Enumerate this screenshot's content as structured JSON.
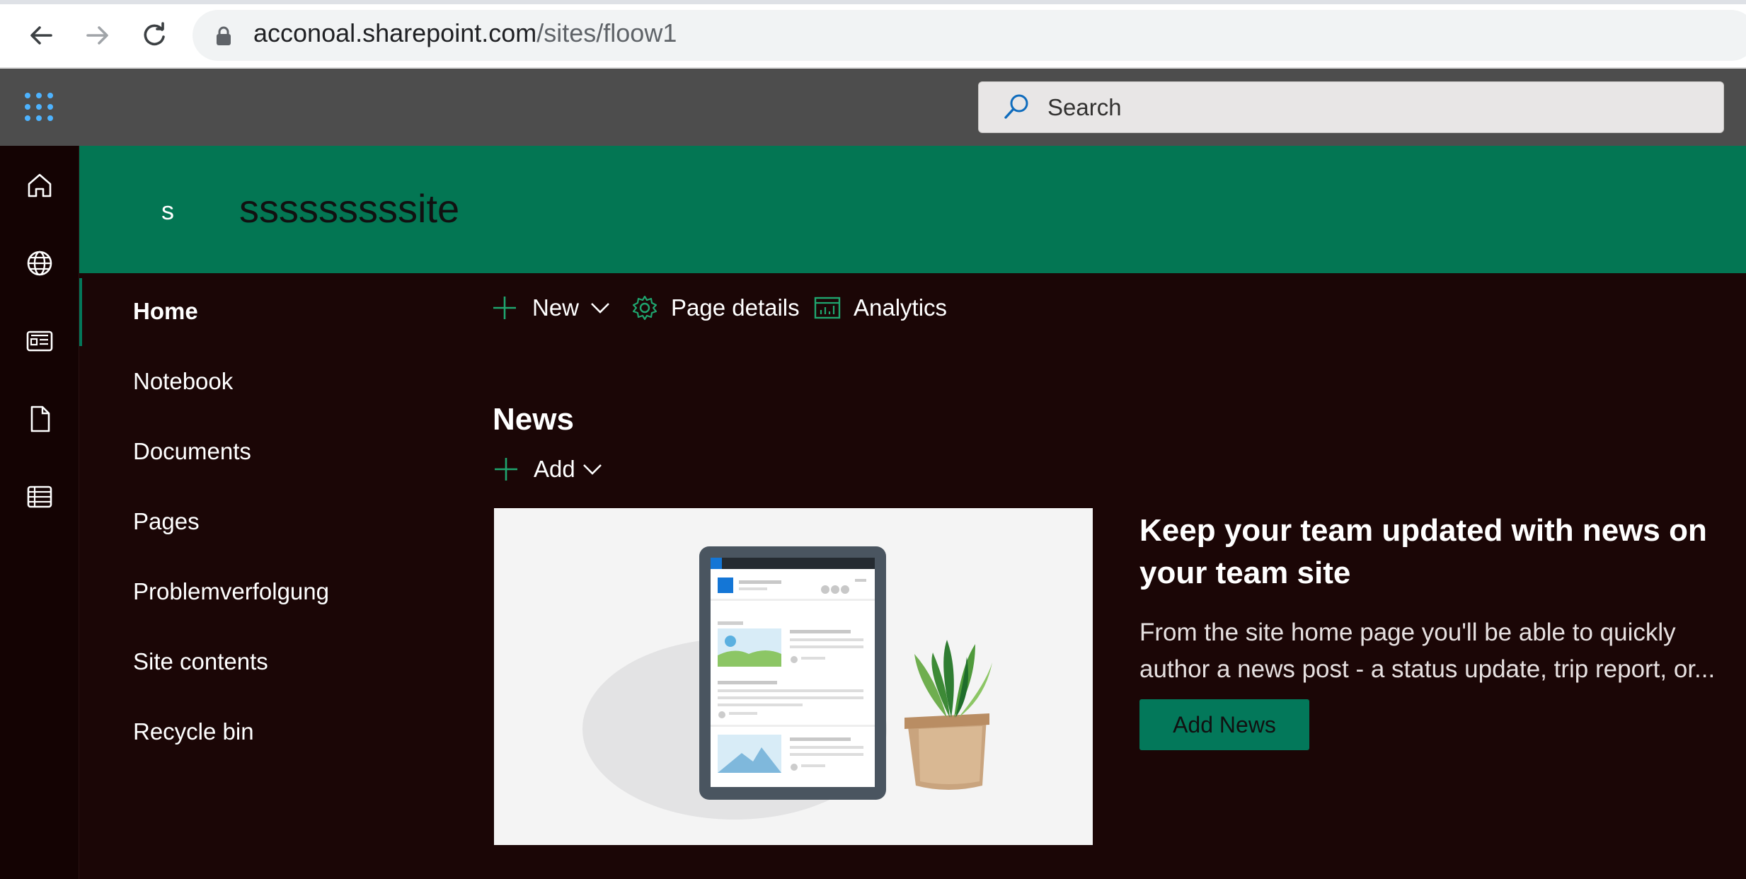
{
  "browser": {
    "url_host": "acconoal.sharepoint.com",
    "url_path": "/sites/floow1"
  },
  "suite_bar": {
    "search_placeholder": "Search"
  },
  "site": {
    "logo_letter": "s",
    "title": "sssssssssite"
  },
  "left_nav": {
    "items": [
      {
        "label": "Home"
      },
      {
        "label": "Notebook"
      },
      {
        "label": "Documents"
      },
      {
        "label": "Pages"
      },
      {
        "label": "Problemverfolgung"
      },
      {
        "label": "Site contents"
      },
      {
        "label": "Recycle bin"
      }
    ]
  },
  "command_bar": {
    "new_label": "New",
    "page_details_label": "Page details",
    "analytics_label": "Analytics"
  },
  "news": {
    "title": "News",
    "add_label": "Add",
    "promo_heading": "Keep your team updated with news on your team site",
    "promo_description": "From the site home page you'll be able to quickly author a news post - a status update, trip report, or...",
    "add_news_button": "Add News"
  },
  "colors": {
    "brand_green": "#037653",
    "page_background": "#1b0606",
    "suite_bar": "#4d4d4d"
  }
}
